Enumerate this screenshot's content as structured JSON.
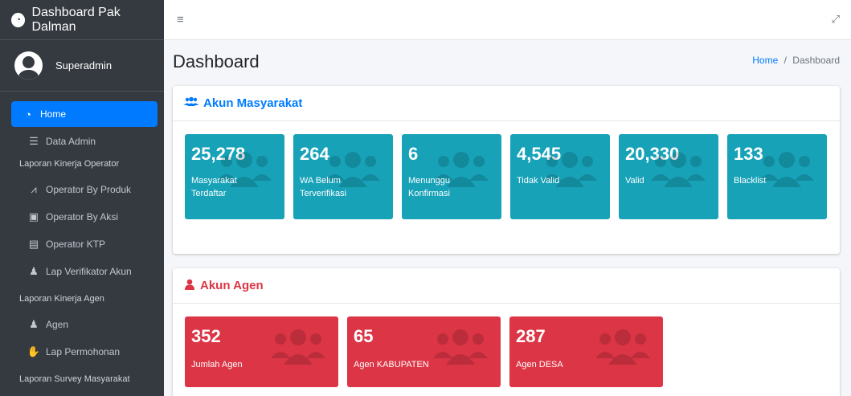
{
  "brand": {
    "title": "Dashboard Pak Dalman"
  },
  "user": {
    "name": "Superadmin"
  },
  "sidebar": {
    "items": [
      {
        "label": "Home"
      },
      {
        "label": "Data Admin"
      }
    ],
    "headers": [
      "Laporan Kinerja Operator",
      "Laporan Kinerja Agen",
      "Laporan Survey Masyarakat"
    ],
    "operator_items": [
      {
        "label": "Operator By Produk"
      },
      {
        "label": "Operator By Aksi"
      },
      {
        "label": "Operator KTP"
      },
      {
        "label": "Lap Verifikator Akun"
      }
    ],
    "agen_items": [
      {
        "label": "Agen"
      },
      {
        "label": "Lap Permohonan"
      }
    ]
  },
  "header": {
    "title": "Dashboard",
    "breadcrumb": {
      "home": "Home",
      "separator": "/",
      "current": "Dashboard"
    }
  },
  "akun_masyarakat": {
    "title": "Akun Masyarakat",
    "boxes": [
      {
        "value": "25,278",
        "label": "Masyarakat Terdaftar"
      },
      {
        "value": "264",
        "label": "WA Belum Terverifikasi"
      },
      {
        "value": "6",
        "label": "Menunggu Konfirmasi"
      },
      {
        "value": "4,545",
        "label": "Tidak Valid"
      },
      {
        "value": "20,330",
        "label": "Valid"
      },
      {
        "value": "133",
        "label": "Blacklist"
      }
    ]
  },
  "akun_agen": {
    "title": "Akun Agen",
    "boxes": [
      {
        "value": "352",
        "label": "Jumlah Agen"
      },
      {
        "value": "65",
        "label": "Agen KABUPATEN"
      },
      {
        "value": "287",
        "label": "Agen DESA"
      }
    ]
  },
  "colors": {
    "sidebar_bg": "#343a40",
    "primary": "#007bff",
    "teal": "#17a2b8",
    "danger": "#dc3545"
  }
}
